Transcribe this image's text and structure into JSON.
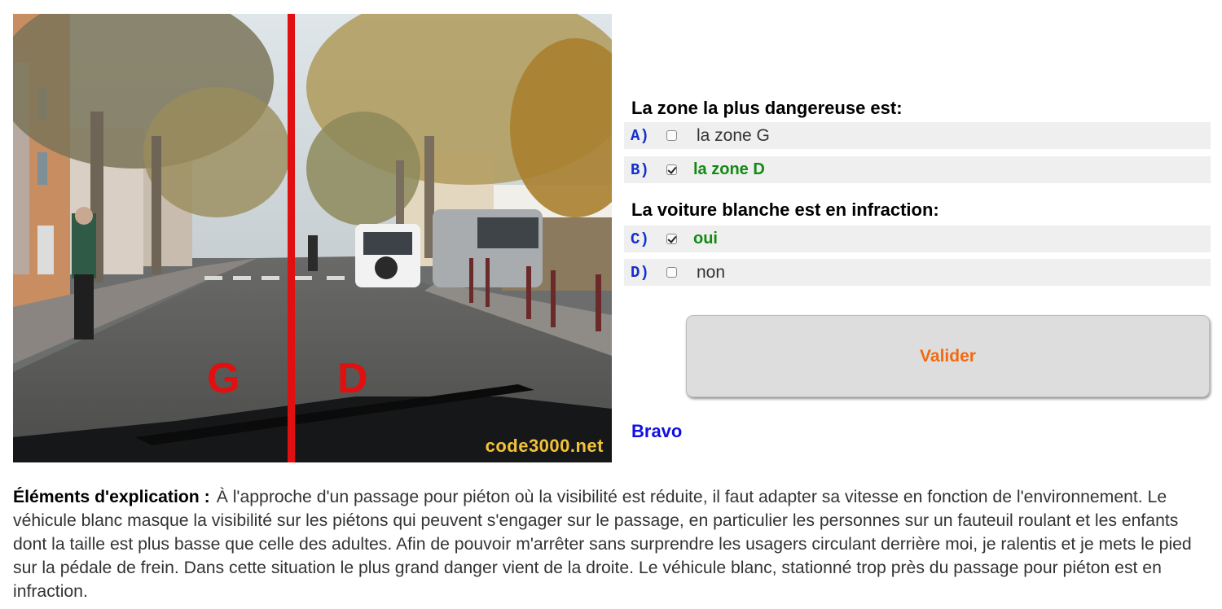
{
  "photo": {
    "zone_left": "G",
    "zone_right": "D",
    "watermark": "code3000.net",
    "divider_color": "#e01010"
  },
  "quiz": {
    "questions": [
      {
        "text": "La zone la plus dangereuse est:",
        "answers": [
          {
            "letter": "A)",
            "text": "la zone G",
            "checked": false,
            "correct": false
          },
          {
            "letter": "B)",
            "text": "la zone D",
            "checked": true,
            "correct": true
          }
        ]
      },
      {
        "text": "La voiture blanche est en infraction:",
        "answers": [
          {
            "letter": "C)",
            "text": "oui",
            "checked": true,
            "correct": true
          },
          {
            "letter": "D)",
            "text": "non",
            "checked": false,
            "correct": false
          }
        ]
      }
    ],
    "validate_label": "Valider",
    "result": "Bravo"
  },
  "explanation": {
    "lead": "Éléments d'explication :",
    "text": "À l'approche d'un passage pour piéton où la visibilité est réduite, il faut adapter sa vitesse en fonction de l'environnement. Le véhicule blanc masque la visibilité sur les piétons qui peuvent s'engager sur le passage, en particulier les personnes sur un fauteuil roulant et les enfants dont la taille est plus basse que celle des adultes. Afin de pouvoir m'arrêter sans surprendre les usagers circulant derrière moi, je ralentis et je mets le pied sur la pédale de frein. Dans cette situation le plus grand danger vient de la droite. Le véhicule blanc, stationné trop près du passage pour piéton est en infraction."
  },
  "colors": {
    "answer_letter": "#1530d0",
    "correct_answer": "#138a13",
    "validate_text": "#f26a10",
    "result_text": "#1010e0",
    "answer_row_bg": "#efefef"
  }
}
